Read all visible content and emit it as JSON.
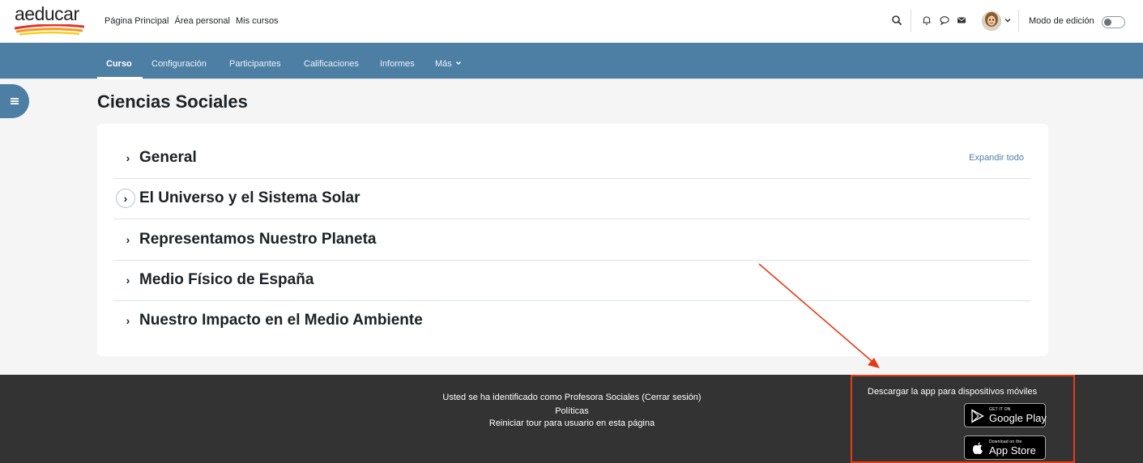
{
  "brand": {
    "logo_text": "aeducar"
  },
  "top_nav": {
    "links": [
      "Página Principal",
      "Área personal",
      "Mis cursos"
    ],
    "edit_mode_label": "Modo de edición",
    "icons": [
      "search-icon",
      "bell-icon",
      "chat-icon",
      "envelope-icon",
      "avatar",
      "chevron-down-icon"
    ]
  },
  "course_nav": {
    "tabs": [
      {
        "label": "Curso",
        "active": true
      },
      {
        "label": "Configuración",
        "active": false
      },
      {
        "label": "Participantes",
        "active": false
      },
      {
        "label": "Calificaciones",
        "active": false
      },
      {
        "label": "Informes",
        "active": false
      },
      {
        "label": "Más",
        "active": false
      }
    ]
  },
  "course": {
    "title": "Ciencias Sociales",
    "expand_all": "Expandir todo",
    "sections": [
      "General",
      "El Universo y el Sistema Solar",
      "Representamos Nuestro Planeta",
      "Medio Físico de España",
      "Nuestro Impacto en el Medio Ambiente"
    ]
  },
  "footer": {
    "logged_in": "Usted se ha identificado como Profesora Sociales (Cerrar sesión)",
    "policies": "Políticas",
    "reset_tour": "Reiniciar tour para usuario en esta página",
    "app_title": "Descargar la app para dispositivos móviles",
    "google_play": {
      "small": "GET IT ON",
      "big": "Google Play"
    },
    "app_store": {
      "small": "Download on the",
      "big": "App Store"
    }
  },
  "colors": {
    "primary": "#4d7ea4",
    "footer_bg": "#333333",
    "annotation": "#e43b17"
  }
}
